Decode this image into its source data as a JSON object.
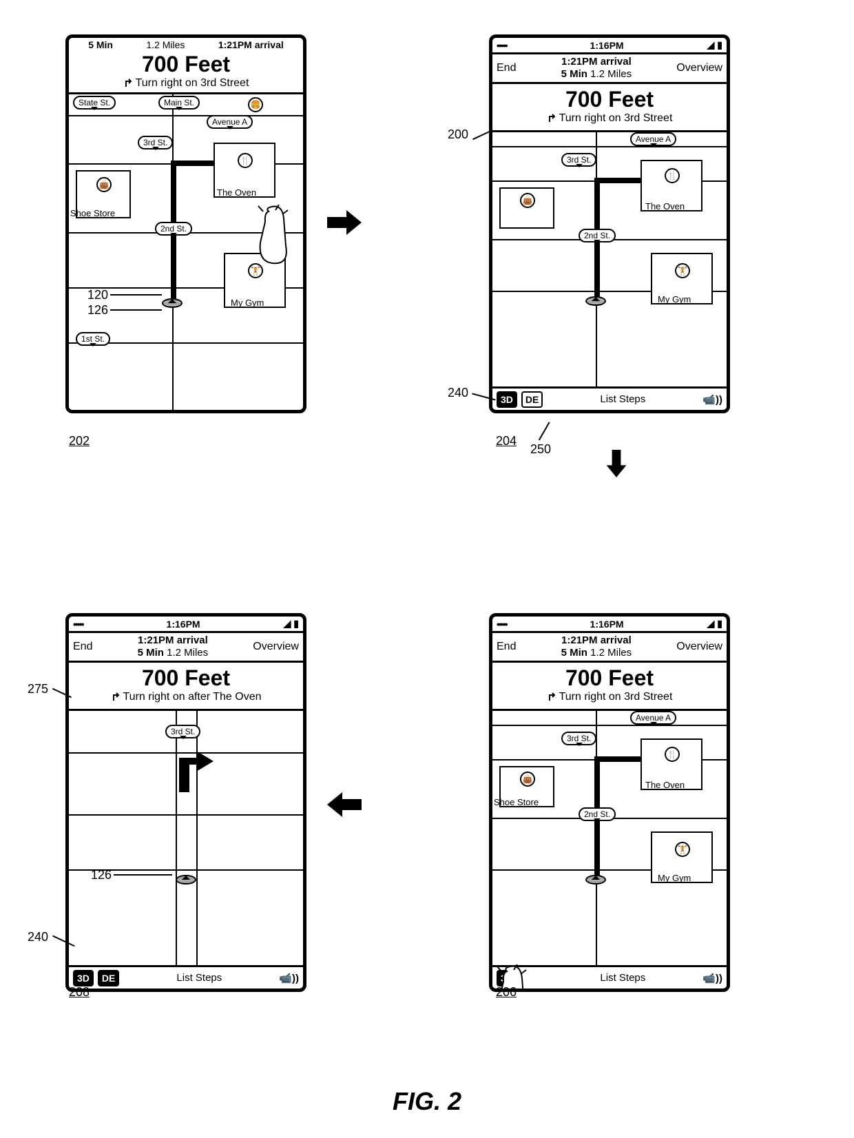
{
  "figure_caption": "FIG. 2",
  "refs": {
    "r200": "200",
    "r202": "202",
    "r204": "204",
    "r206": "206",
    "r208": "208",
    "r240a": "240",
    "r240b": "240",
    "r250": "250",
    "r275": "275",
    "r120": "120",
    "r126a": "126",
    "r126b": "126"
  },
  "status": {
    "time": "1:16PM",
    "dots": "•••••"
  },
  "nav": {
    "end": "End",
    "overview": "Overview",
    "arrival": "1:21PM arrival",
    "summary_bold": "5 Min",
    "summary_rest": " 1.2 Miles"
  },
  "topinfo202": {
    "c1": "5 Min",
    "c2": "1.2 Miles",
    "c3": "1:21PM arrival"
  },
  "direction": {
    "distance": "700 Feet",
    "instr": "Turn right on 3rd Street",
    "instr_de": "Turn right on after The Oven"
  },
  "roads": {
    "state": "State St.",
    "main": "Main St.",
    "avea": "Avenue A",
    "third": "3rd St.",
    "second": "2nd St.",
    "first": "1st St."
  },
  "poi": {
    "shoe": "Shoe Store",
    "oven": "The Oven",
    "gym": "My Gym"
  },
  "bottombar": {
    "btn3d": "3D",
    "btnde": "DE",
    "liststeps": "List Steps"
  }
}
